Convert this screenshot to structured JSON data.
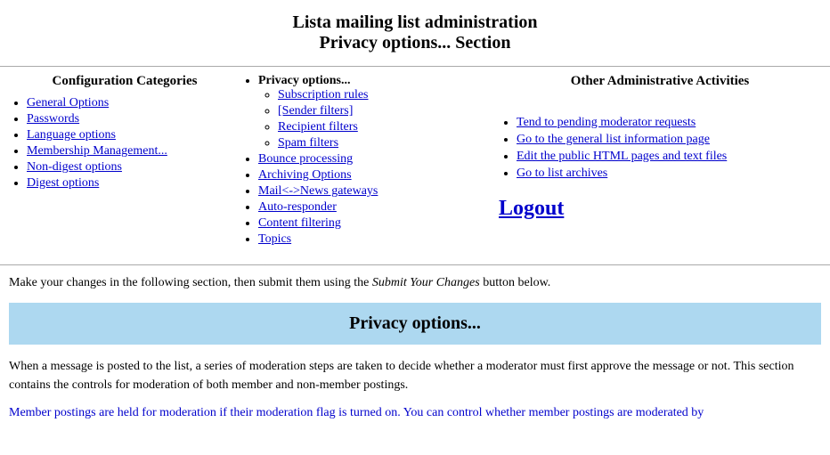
{
  "header": {
    "line1": "Lista mailing list administration",
    "line2": "Privacy options... Section"
  },
  "config_categories_label": "Configuration Categories",
  "other_admin_label": "Other Administrative Activities",
  "left_nav": {
    "items": [
      {
        "label": "General Options",
        "href": "#"
      },
      {
        "label": "Passwords",
        "href": "#"
      },
      {
        "label": "Language options",
        "href": "#"
      },
      {
        "label": "Membership Management...",
        "href": "#"
      },
      {
        "label": "Non-digest options",
        "href": "#"
      },
      {
        "label": "Digest options",
        "href": "#"
      }
    ]
  },
  "middle_nav": {
    "top_label": "Privacy options...",
    "sub_items": [
      {
        "label": "Subscription rules",
        "href": "#"
      },
      {
        "label": "[Sender filters]",
        "href": "#"
      },
      {
        "label": "Recipient filters",
        "href": "#"
      },
      {
        "label": "Spam filters",
        "href": "#"
      }
    ],
    "bottom_items": [
      {
        "label": "Bounce processing",
        "href": "#"
      },
      {
        "label": "Archiving Options",
        "href": "#"
      },
      {
        "label": "Mail<->News gateways",
        "href": "#"
      },
      {
        "label": "Auto-responder",
        "href": "#"
      },
      {
        "label": "Content filtering",
        "href": "#"
      },
      {
        "label": "Topics",
        "href": "#"
      }
    ]
  },
  "right_nav": {
    "items": [
      {
        "label": "Tend to pending moderator requests",
        "href": "#"
      },
      {
        "label": "Go to the general list information page",
        "href": "#"
      },
      {
        "label": "Edit the public HTML pages and text files",
        "href": "#"
      },
      {
        "label": "Go to list archives",
        "href": "#"
      }
    ],
    "logout_label": "Logout"
  },
  "submit_note": "Make your changes in the following section, then submit them using the",
  "submit_note_italic": "Submit Your Changes",
  "submit_note_end": "button below.",
  "section_banner": "Privacy options...",
  "description1": "When a message is posted to the list, a series of moderation steps are taken to decide whether a moderator must first approve the message or not. This section contains the controls for moderation of both member and non-member postings.",
  "description2_partial": "Member postings are held for moderation if their moderation flag is turned on. You can control whether member postings are moderated by"
}
